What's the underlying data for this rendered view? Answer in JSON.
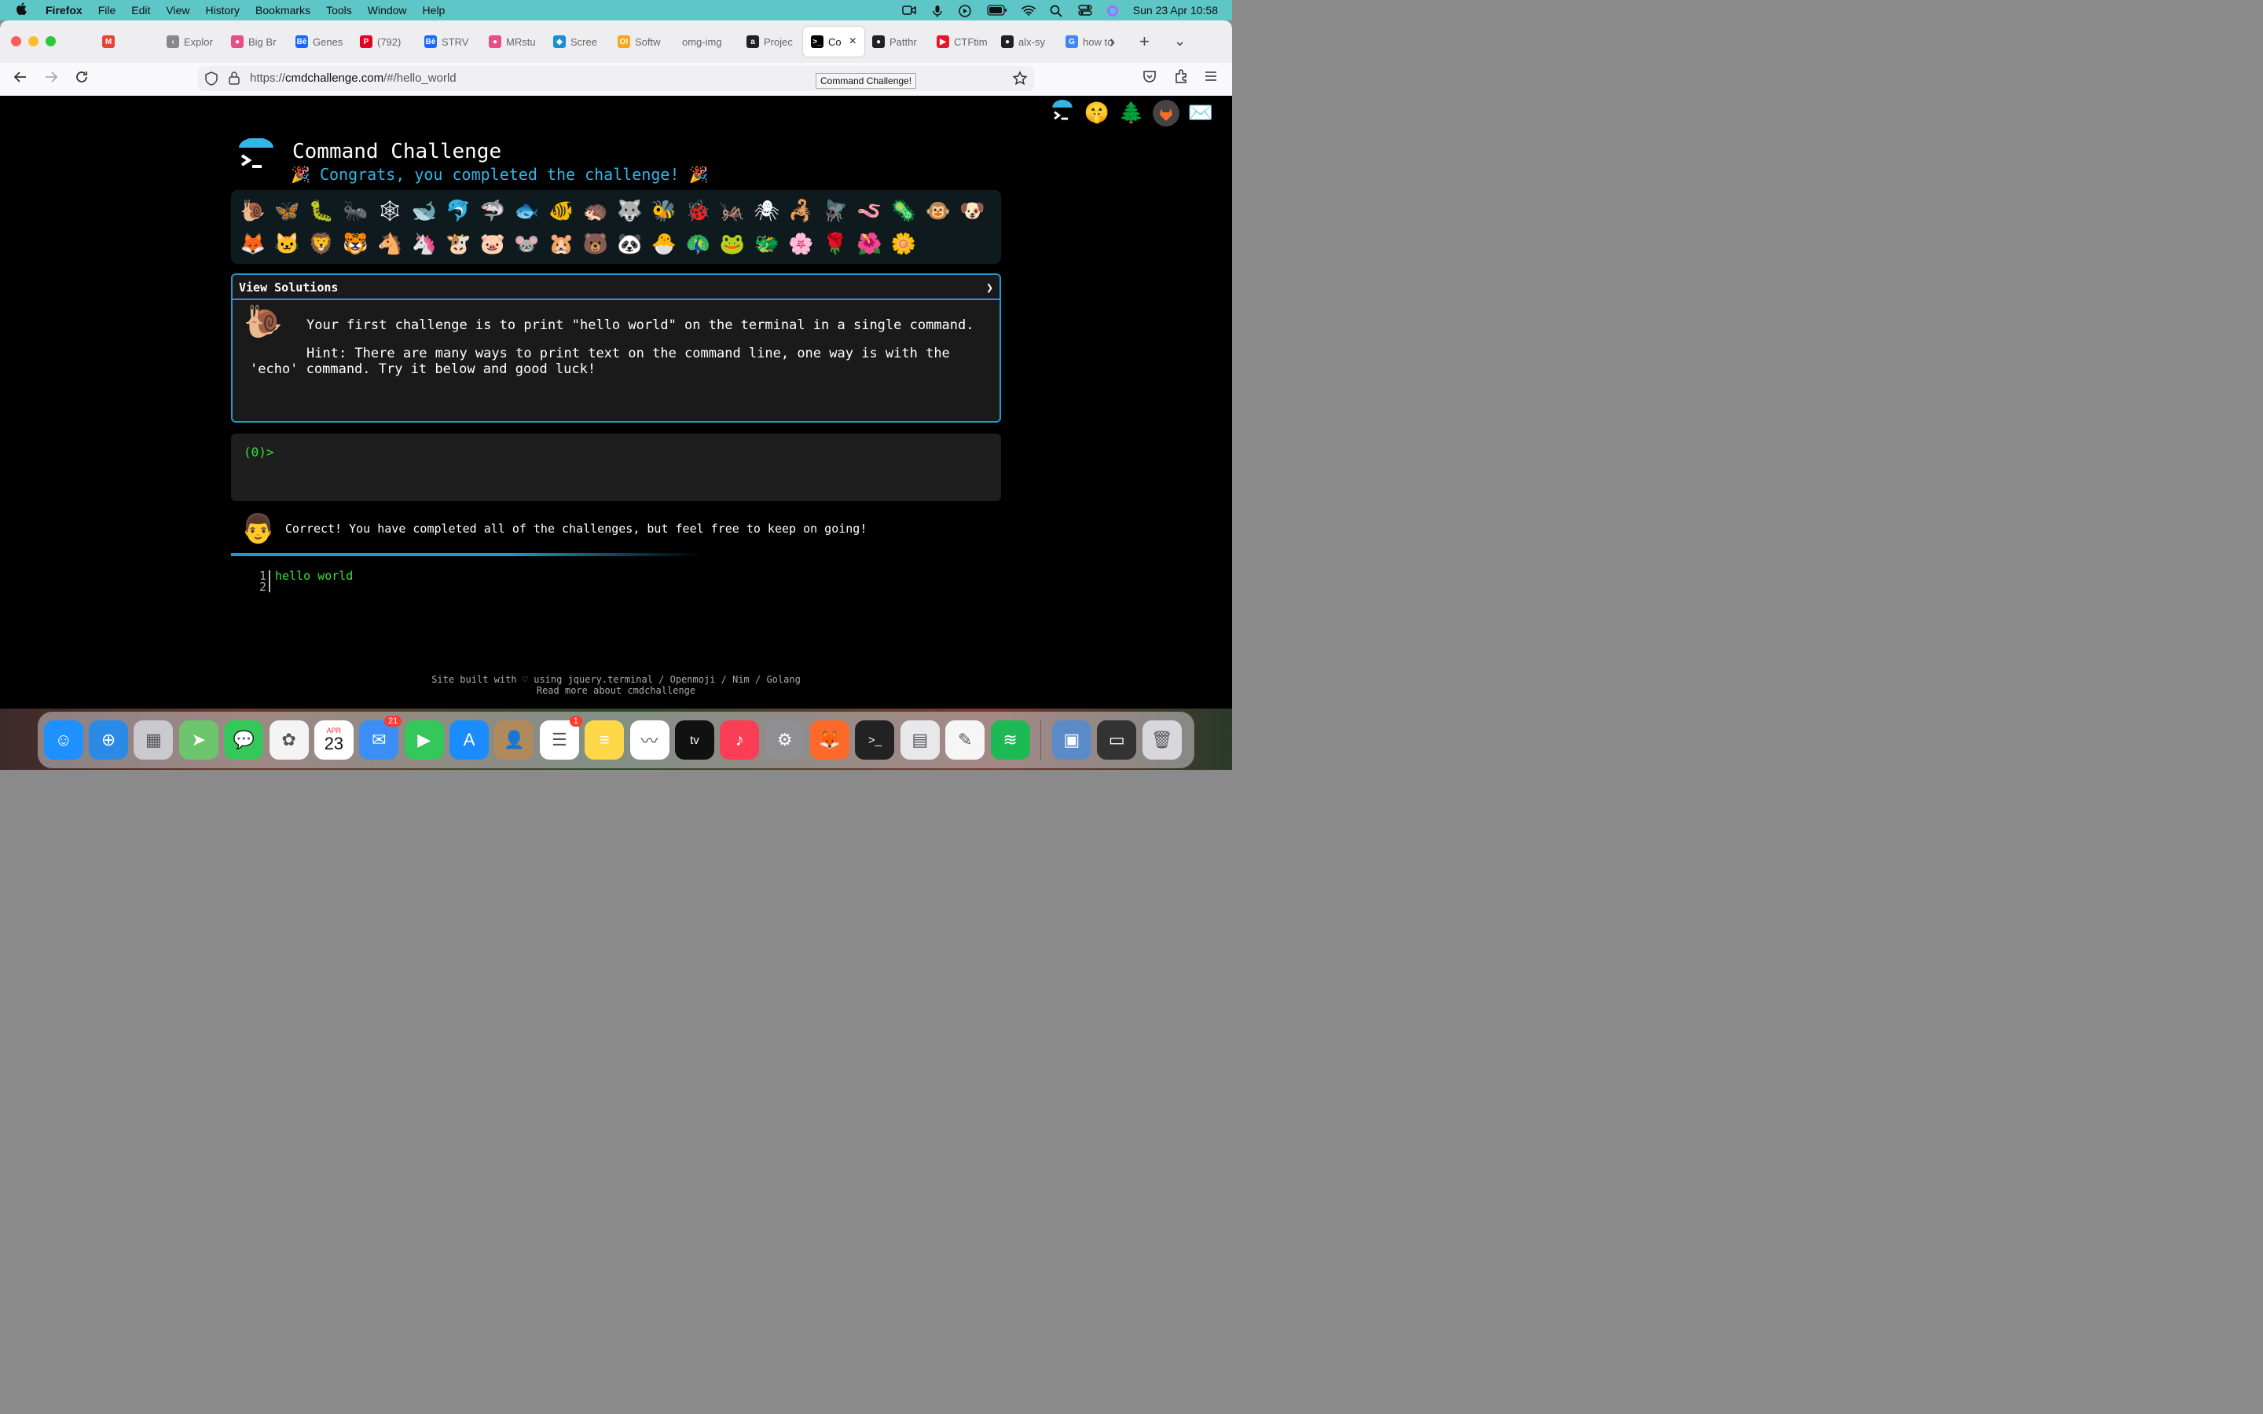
{
  "menubar": {
    "apple": "",
    "items": [
      "Firefox",
      "File",
      "Edit",
      "View",
      "History",
      "Bookmarks",
      "Tools",
      "Window",
      "Help"
    ],
    "clock": "Sun 23 Apr  10:58"
  },
  "browser": {
    "tabs": [
      {
        "label": "",
        "icon": "gmail-icon",
        "color": "#ea4335",
        "glyph": "M"
      },
      {
        "label": "Explor",
        "icon": "chevron-left-icon",
        "color": "#888888",
        "glyph": "‹"
      },
      {
        "label": "Big Br",
        "icon": "dribbble-icon",
        "color": "#ea4c89",
        "glyph": "●"
      },
      {
        "label": "Genes",
        "icon": "behance-icon",
        "color": "#1769ff",
        "glyph": "Bē"
      },
      {
        "label": "(792) ",
        "icon": "pinterest-icon",
        "color": "#e60023",
        "glyph": "P"
      },
      {
        "label": "STRV",
        "icon": "behance-icon",
        "color": "#1769ff",
        "glyph": "Bē"
      },
      {
        "label": "MRstu",
        "icon": "dribbble-icon",
        "color": "#ea4c89",
        "glyph": "●"
      },
      {
        "label": "Scree",
        "icon": "screen-icon",
        "color": "#1b8fd6",
        "glyph": "◆"
      },
      {
        "label": "Softw",
        "icon": "software-icon",
        "color": "#f5a623",
        "glyph": "O!"
      },
      {
        "label": "omg-img",
        "icon": "",
        "color": "#eeeef0",
        "glyph": ""
      },
      {
        "label": "Projec",
        "icon": "alx-icon",
        "color": "#222222",
        "glyph": "a"
      },
      {
        "label": "Co",
        "icon": "terminal-icon",
        "color": "#000000",
        "glyph": ">_",
        "active": true
      },
      {
        "label": "Patthr",
        "icon": "github-icon",
        "color": "#222222",
        "glyph": "●"
      },
      {
        "label": "CTFtim",
        "icon": "ctftime-icon",
        "color": "#e8172c",
        "glyph": "▶"
      },
      {
        "label": "alx-sy",
        "icon": "github-icon",
        "color": "#222222",
        "glyph": "●"
      },
      {
        "label": "how to",
        "icon": "google-icon",
        "color": "#4285f4",
        "glyph": "G"
      }
    ],
    "url_prefix": "https://",
    "url_host": "cmdchallenge.com",
    "url_path": "/#/hello_world",
    "tooltip": "Command Challenge!"
  },
  "page": {
    "title": "Command Challenge",
    "subtitle": "🎉 Congrats, you completed the challenge! 🎉",
    "emojis": [
      "🐌",
      "🦋",
      "🐛",
      "🐜",
      "🕸",
      "🐋",
      "🐬",
      "🦈",
      "🐟",
      "🐠",
      "🦔",
      "🐺",
      "🐝",
      "🐞",
      "🦗",
      "🕷",
      "🦂",
      "🪰",
      "🪱",
      "🦠",
      "🐵",
      "🐶",
      "🦊",
      "🐱",
      "🦁",
      "🐯",
      "🐴",
      "🦄",
      "🐮",
      "🐷",
      "🐭",
      "🐹",
      "🐻",
      "🐼",
      "🐣",
      "🦚",
      "🐸",
      "🐲",
      "🌸",
      "🌹",
      "🌺",
      "🌼"
    ],
    "solutions_label": "View Solutions",
    "solutions_chevron": "❯",
    "challenge_text": "Your first challenge is to print \"hello world\" on the terminal in a single command.",
    "hint_text": "Hint: There are many ways to print text on the command line, one way is with the 'echo' command. Try it below and good luck!",
    "prompt": "(0)>",
    "result_message": "Correct! You have completed all of the challenges, but feel free to keep on going!",
    "output_lines": [
      {
        "num": "1",
        "text": "hello world"
      },
      {
        "num": "2",
        "text": ""
      }
    ],
    "footer_line1": "Site built with ♡ using jquery.terminal / Openmoji / Nim / Golang",
    "footer_line2": "Read more about cmdchallenge"
  },
  "dock": {
    "calendar_month": "APR",
    "calendar_day": "23",
    "mail_badge": "21",
    "reminders_badge": "1",
    "apps": [
      {
        "name": "finder-icon",
        "color": "#1e90ff"
      },
      {
        "name": "safari-icon",
        "color": "#2b8ae6"
      },
      {
        "name": "launchpad-icon",
        "color": "#c9c9cf"
      },
      {
        "name": "maps-icon",
        "color": "#6cc46c"
      },
      {
        "name": "messages-icon",
        "color": "#34c759"
      },
      {
        "name": "photos-icon",
        "color": "#f4f4f4"
      },
      {
        "name": "calendar-icon",
        "color": "#ffffff"
      },
      {
        "name": "mail-icon",
        "color": "#3a8ef6"
      },
      {
        "name": "facetime-icon",
        "color": "#34c759"
      },
      {
        "name": "app-store-icon",
        "color": "#1a8cff"
      },
      {
        "name": "contacts-icon",
        "color": "#b08a5c"
      },
      {
        "name": "reminders-icon",
        "color": "#ffffff"
      },
      {
        "name": "notes-icon",
        "color": "#ffd84a"
      },
      {
        "name": "freeform-icon",
        "color": "#ffffff"
      },
      {
        "name": "apple-tv-icon",
        "color": "#111111"
      },
      {
        "name": "music-icon",
        "color": "#fa3e55"
      },
      {
        "name": "system-settings-icon",
        "color": "#8e8e93"
      },
      {
        "name": "firefox-icon",
        "color": "#ff6a2a"
      },
      {
        "name": "terminal-icon",
        "color": "#222222"
      },
      {
        "name": "preview-icon",
        "color": "#e8e8ea"
      },
      {
        "name": "textedit-icon",
        "color": "#f6f6f6"
      },
      {
        "name": "spotify-icon",
        "color": "#1db954"
      },
      {
        "name": "folder-stack-icon",
        "color": "#5a8ac8"
      },
      {
        "name": "recent-screenshot-icon",
        "color": "#333333"
      },
      {
        "name": "trash-icon",
        "color": "#d8d8dc"
      }
    ]
  }
}
